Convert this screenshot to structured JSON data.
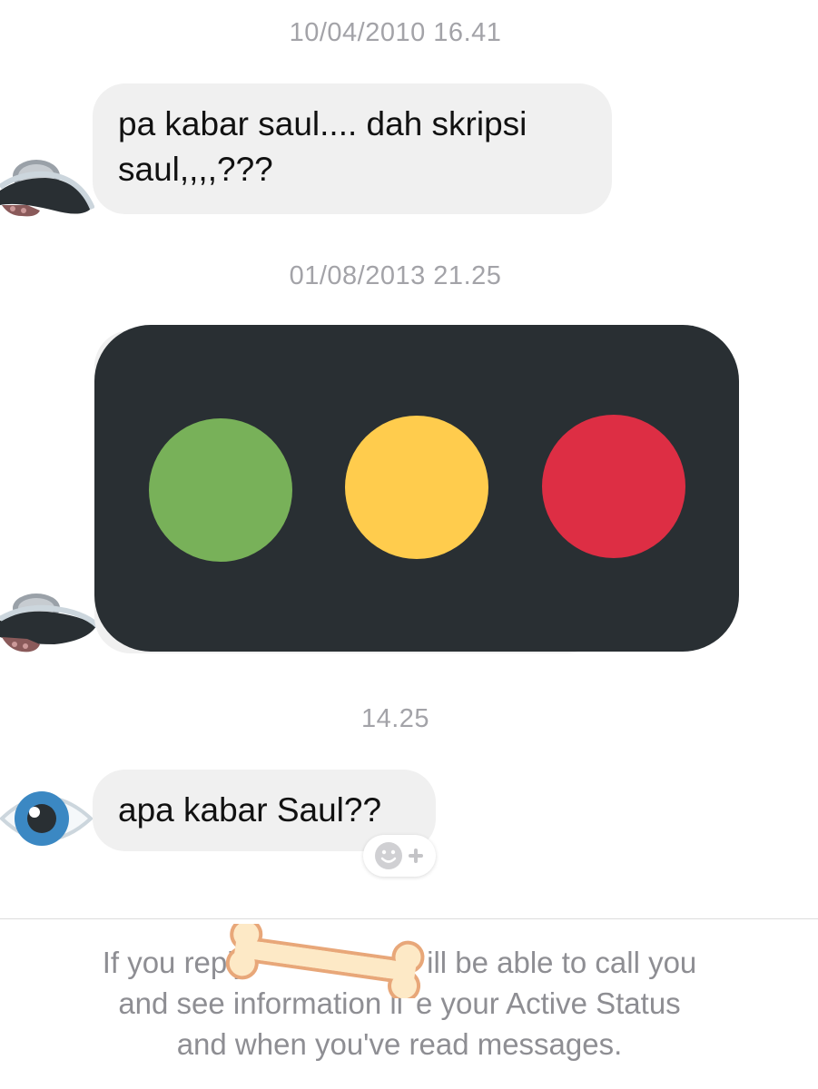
{
  "conversation": {
    "timestamps": [
      "10/04/2010 16.41",
      "01/08/2013 21.25",
      "14.25"
    ],
    "messages": [
      {
        "text": "pa kabar saul.... dah skripsi\nsaul,,,,???",
        "sender_avatar_icon": "ufo-icon"
      },
      {
        "image_icon": "horizontal-traffic-light-icon",
        "light_colors": [
          "#78b159",
          "#ffcc4d",
          "#dd2e44"
        ],
        "sender_avatar_icon": "ufo-icon"
      },
      {
        "text": "apa kabar Saul??",
        "sender_avatar_icon": "eye-icon"
      }
    ],
    "reaction_button_icon": "add-reaction-icon"
  },
  "footer": {
    "notice": "If you reply           ill be able to call you and see information like your Active Status and when you've read messages.",
    "notice_line1": "If you reply",
    "notice_line1_end": "ill be able to call you",
    "notice_line2_start": "and see information li",
    "notice_line2_end": "e your Active Status",
    "notice_line3": "and when you've read messages.",
    "censor_icon": "bone-icon"
  }
}
